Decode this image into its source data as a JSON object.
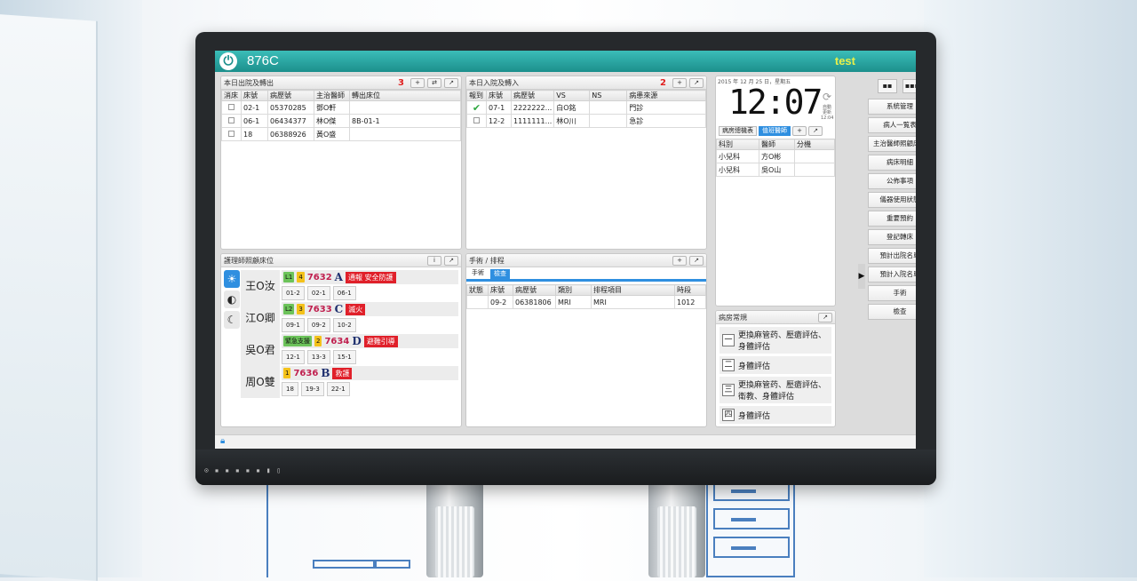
{
  "app": {
    "title": "876C",
    "user": "test"
  },
  "bezel": {
    "icons": "⊙ ▪ ▪ ▪ ▪ ▪ ▮ ▯"
  },
  "discharge": {
    "title": "本日出院及轉出",
    "count": "3",
    "tools": [
      "+",
      "⇄",
      "↗"
    ],
    "columns": [
      "消床",
      "床號",
      "病歷號",
      "主治醫師",
      "轉出床位"
    ],
    "rows": [
      [
        "",
        "02-1",
        "05370285",
        "鄧O軒",
        ""
      ],
      [
        "",
        "06-1",
        "06434377",
        "林O傑",
        "8B-01-1"
      ],
      [
        "",
        "18",
        "06388926",
        "黃O盛",
        ""
      ]
    ]
  },
  "admission": {
    "title": "本日入院及轉入",
    "count": "2",
    "tools": [
      "+",
      "↗"
    ],
    "columns": [
      "報到",
      "床號",
      "病歷號",
      "VS",
      "NS",
      "病患來源"
    ],
    "rows": [
      [
        "✔",
        "07-1",
        "2222222...",
        "白O銘",
        "",
        "門診"
      ],
      [
        "",
        "12-2",
        "1111111...",
        "林O川",
        "",
        "急診"
      ]
    ]
  },
  "nurse": {
    "title": "護理師照顧床位",
    "tools": [
      "i",
      "↗"
    ],
    "shift_icons": [
      "☀",
      "◐",
      "☾"
    ],
    "rows": [
      {
        "name": "王O汝",
        "tags": [
          "L1",
          "4"
        ],
        "ext": "7632",
        "team": "A",
        "alert": "通報 安全防護",
        "beds": [
          "01-2",
          "02-1",
          "06-1"
        ]
      },
      {
        "name": "江O卿",
        "tags": [
          "L2",
          "3"
        ],
        "ext": "7633",
        "team": "C",
        "alert": "滅火",
        "beds": [
          "09-1",
          "09-2",
          "10-2"
        ]
      },
      {
        "name": "吳O君",
        "tags": [
          "緊急支援",
          "2"
        ],
        "ext": "7634",
        "team": "D",
        "alert": "避難引導",
        "beds": [
          "12-1",
          "13-3",
          "15-1"
        ]
      },
      {
        "name": "周O雙",
        "tags": [
          "1"
        ],
        "ext": "7636",
        "team": "B",
        "alert": "救護",
        "beds": [
          "18",
          "19-3",
          "22-1"
        ]
      }
    ]
  },
  "surgery": {
    "title": "手術 / 排程",
    "tools": [
      "+",
      "↗"
    ],
    "tabs": [
      "手術",
      "檢查"
    ],
    "columns": [
      "狀態",
      "床號",
      "病歷號",
      "類別",
      "排程項目",
      "時段"
    ],
    "rows": [
      [
        "",
        "09-2",
        "06381806",
        "MRI",
        "MRI",
        "1012"
      ]
    ]
  },
  "clock": {
    "date": "2015 年 12 月 25 日，星期五",
    "time": "12:07",
    "refresh_label": "自動更新 12:04"
  },
  "contacts": {
    "tabs": [
      "病房總機表",
      "值班醫師"
    ],
    "tools": [
      "+",
      "↗"
    ],
    "columns": [
      "科別",
      "醫師",
      "分機"
    ],
    "rows": [
      [
        "小兒科",
        "方O彬",
        ""
      ],
      [
        "小兒科",
        "吳O山",
        ""
      ]
    ]
  },
  "rules": {
    "title": "病房常規",
    "tools": [
      "↗"
    ],
    "items": [
      {
        "num": "一",
        "text": "更換麻管药、壓瘡評估、身體評估"
      },
      {
        "num": "二",
        "text": "身體評估"
      },
      {
        "num": "三",
        "text": "更換麻管药、壓瘡評估、衛教、身體評估"
      },
      {
        "num": "四",
        "text": "身體評估"
      }
    ]
  },
  "menu": {
    "view_toggles": [
      "▪▪",
      "▪▪▪"
    ],
    "items": [
      "系統管理",
      "病人一覧表",
      "主治醫師照顧床位",
      "病床明細",
      "公佈事項",
      "儀器使用狀態",
      "重要預約",
      "登記轉床",
      "預計出院名單",
      "預計入院名單",
      "手術",
      "檢查"
    ]
  }
}
